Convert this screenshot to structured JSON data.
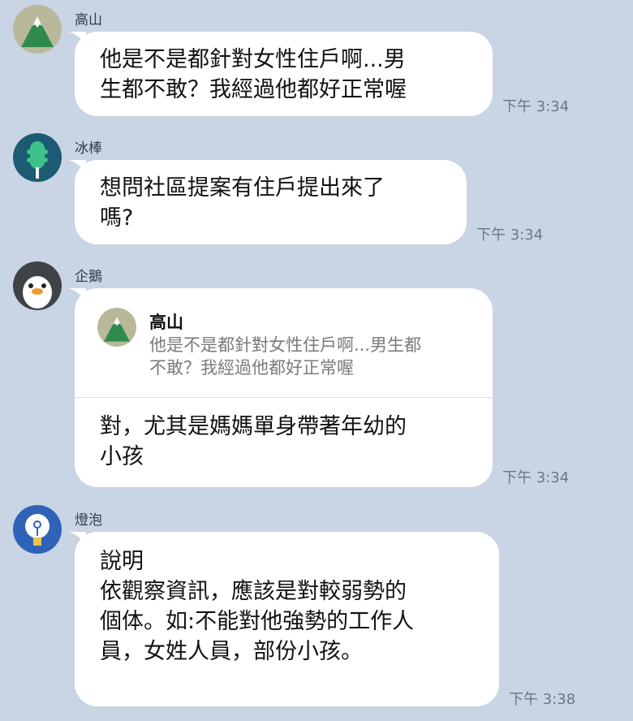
{
  "messages": [
    {
      "sender": "高山",
      "avatar_icon": "mountain-icon",
      "text": "他是不是都針對女性住戶啊...男\n生都不敢？我經過他都好正常喔",
      "time": "下午 3:34"
    },
    {
      "sender": "冰棒",
      "avatar_icon": "popsicle-icon",
      "text": "想問社區提案有住戶提出來了\n嗎?",
      "time": "下午 3:34"
    },
    {
      "sender": "企鵝",
      "avatar_icon": "penguin-icon",
      "reply": {
        "sender": "高山",
        "avatar_icon": "mountain-icon",
        "text": "他是不是都針對女性住戶啊...男生都\n不敢？我經過他都好正常喔"
      },
      "text": "對，尤其是媽媽單身帶著年幼的\n小孩",
      "time": "下午 3:34"
    },
    {
      "sender": "燈泡",
      "avatar_icon": "lightbulb-icon",
      "text": "說明\n依觀察資訊，應該是對較弱勢的\n個体。如:不能對他強勢的工作人\n員，女姓人員，部份小孩。",
      "time": "下午 3:38"
    }
  ],
  "colors": {
    "background": "#c9d5e5",
    "bubble": "#ffffff",
    "time_text": "#6d7685"
  }
}
